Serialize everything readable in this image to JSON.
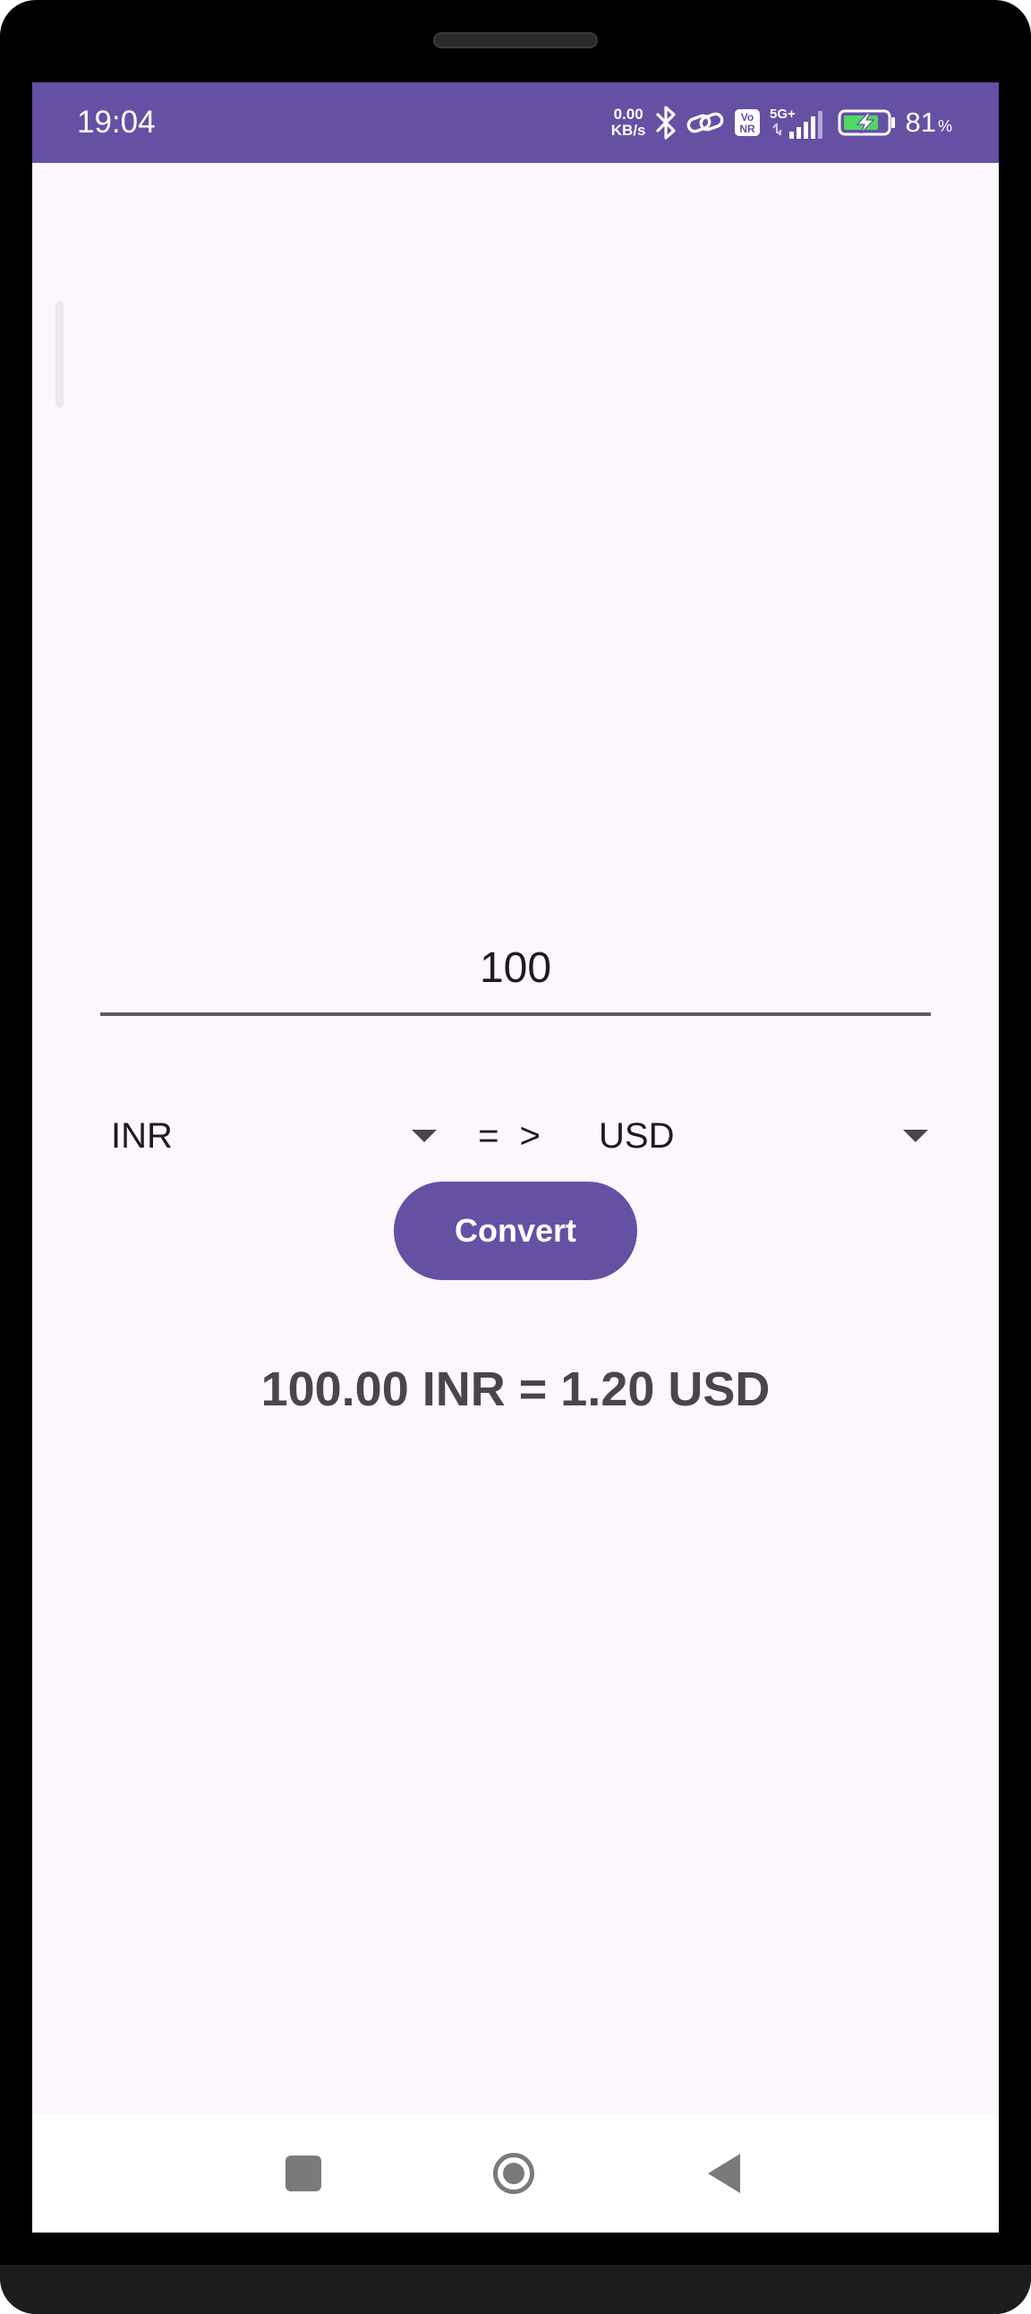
{
  "status_bar": {
    "time": "19:04",
    "net_speed_value": "0.00",
    "net_speed_unit": "KB/s",
    "network_type": "5G+",
    "volte_top": "Vo",
    "volte_bottom": "NR",
    "battery_percent": "81",
    "battery_percent_sign": "%",
    "icons": [
      "bluetooth-icon",
      "link-icon",
      "volte-icon",
      "signal-icon",
      "battery-charging-icon"
    ],
    "background_color": "#6650a4"
  },
  "converter": {
    "amount_value": "100",
    "from_currency": "INR",
    "to_currency": "USD",
    "arrow_text": "= >",
    "convert_label": "Convert",
    "result": "100.00 INR = 1.20 USD",
    "accent_color": "#6650a4"
  },
  "nav_bar": {
    "icons": [
      "recents-icon",
      "home-icon",
      "back-icon"
    ]
  }
}
